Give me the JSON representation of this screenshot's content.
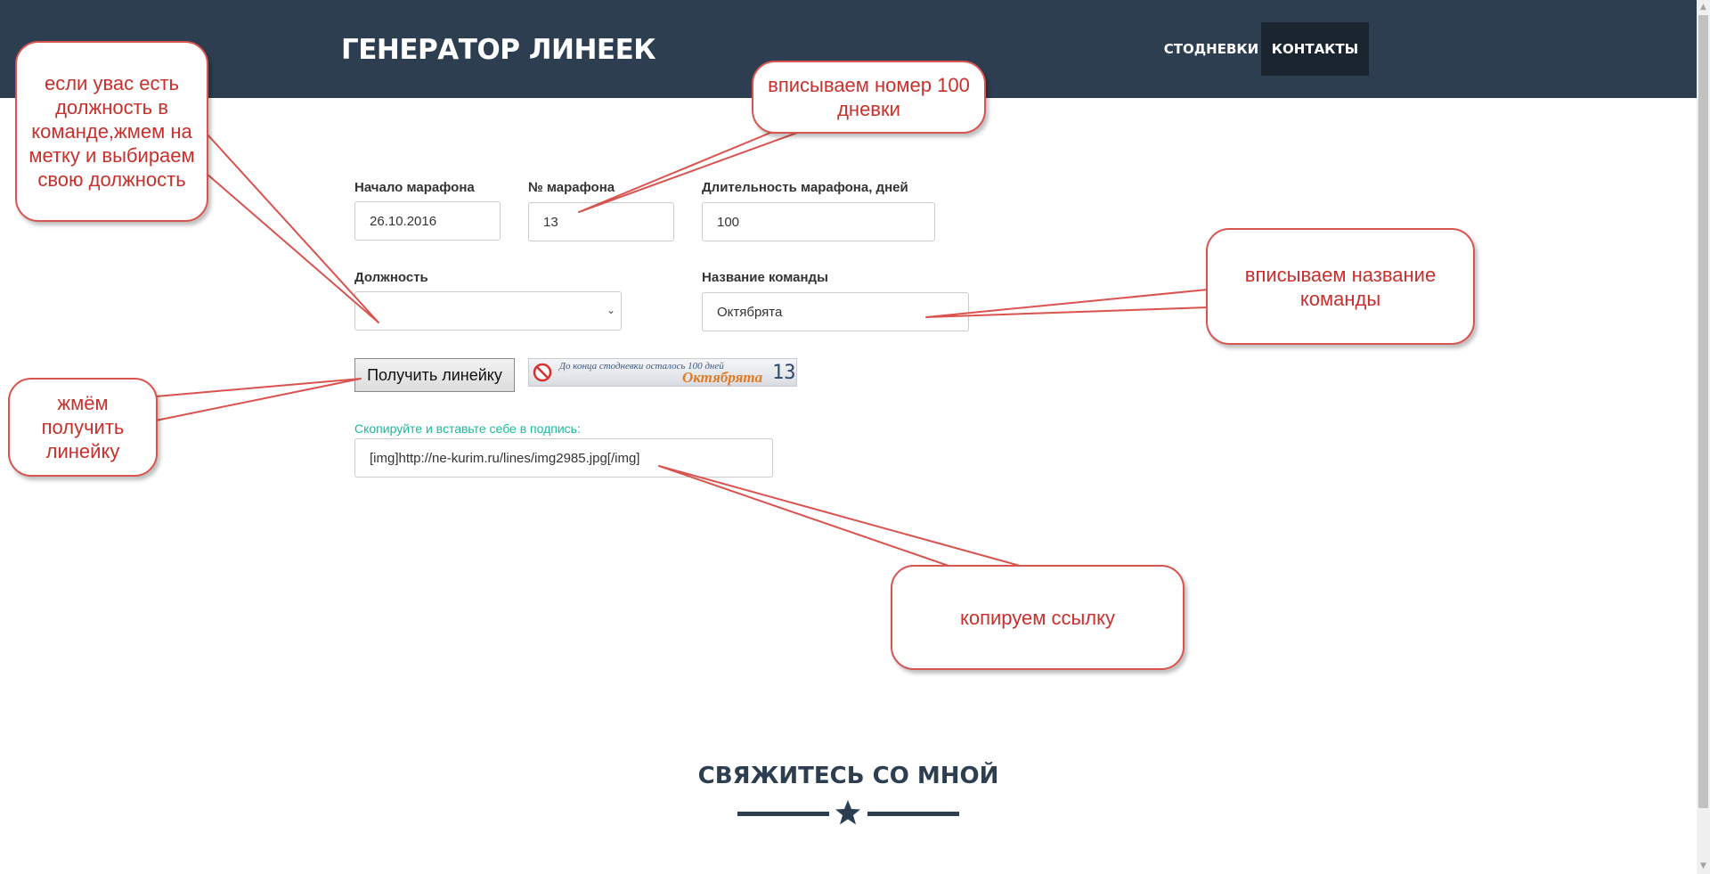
{
  "navbar": {
    "brand": "ГЕНЕРАТОР ЛИНЕЕК",
    "links": [
      "СТОДНЕВКИ",
      "КОНТАКТЫ"
    ],
    "bg_color": "#2c3e50",
    "active_color": "#1a252f"
  },
  "form": {
    "start": {
      "label": "Начало марафона",
      "value": "26.10.2016"
    },
    "number": {
      "label": "№ марафона",
      "value": "13"
    },
    "duration": {
      "label": "Длительность марафона, дней",
      "value": "100"
    },
    "position": {
      "label": "Должность",
      "value": ""
    },
    "team": {
      "label": "Название команды",
      "value": "Октябрята"
    },
    "submit_label": "Получить линейку",
    "copy_hint": "Скопируйте и вставьте себе в подпись:",
    "copy_value": "[img]http://ne-kurim.ru/lines/img2985.jpg[/img]"
  },
  "ruler": {
    "text": "До конца стодневки осталось 100 дней",
    "team": "Октябрята",
    "number": "13"
  },
  "contact": {
    "title": "СВЯЖИТЕСЬ СО МНОЙ"
  },
  "callouts": {
    "position": "если увас есть должность в команде,жмем на метку и выбираем свою должность",
    "number": "вписываем номер 100 дневки",
    "team": "вписываем название команды",
    "button": "жмём получить линейку",
    "copy": "копируем ссылку"
  },
  "colors": {
    "accent": "#18bc9c",
    "callout": "#d9534f"
  }
}
